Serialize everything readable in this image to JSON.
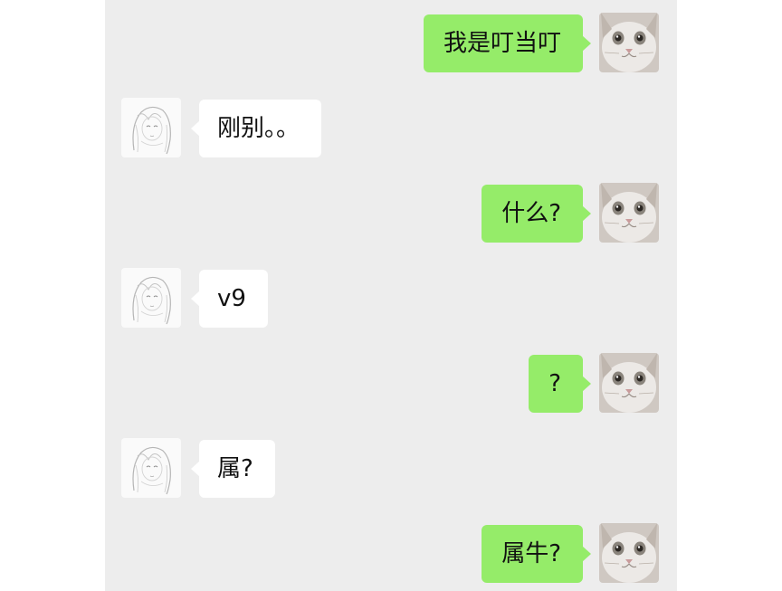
{
  "chat": {
    "messages": [
      {
        "sender": "me",
        "avatar": "cat-avatar-icon",
        "text": "我是叮当叮"
      },
      {
        "sender": "them",
        "avatar": "sketch-girl-avatar-icon",
        "text": "刚别。。"
      },
      {
        "sender": "me",
        "avatar": "cat-avatar-icon",
        "text": "什么?"
      },
      {
        "sender": "them",
        "avatar": "sketch-girl-avatar-icon",
        "text": "v9"
      },
      {
        "sender": "me",
        "avatar": "cat-avatar-icon",
        "text": "?"
      },
      {
        "sender": "them",
        "avatar": "sketch-girl-avatar-icon",
        "text": "属?"
      },
      {
        "sender": "me",
        "avatar": "cat-avatar-icon",
        "text": "属牛?"
      }
    ]
  },
  "colors": {
    "background": "#ededed",
    "outgoing_bubble": "#95ec69",
    "incoming_bubble": "#ffffff"
  }
}
